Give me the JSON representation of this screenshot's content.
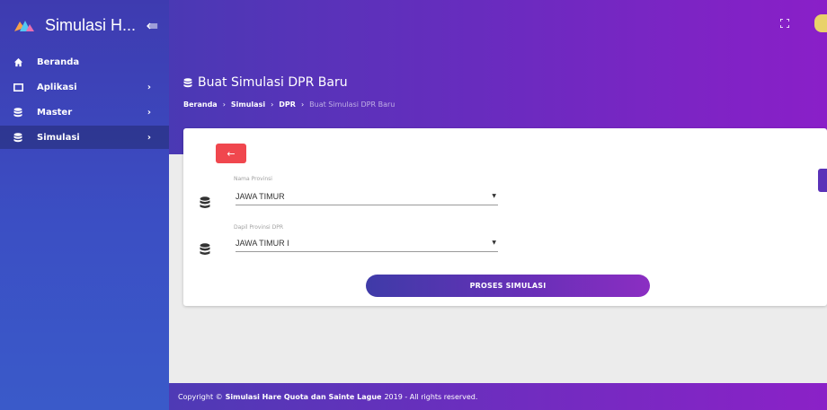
{
  "app": {
    "title": "Simulasi H..."
  },
  "sidebar": {
    "items": [
      {
        "label": "Beranda",
        "icon": "home-icon"
      },
      {
        "label": "Aplikasi",
        "icon": "window-icon"
      },
      {
        "label": "Master",
        "icon": "database-icon"
      },
      {
        "label": "Simulasi",
        "icon": "database-icon",
        "active": true
      }
    ]
  },
  "header": {
    "page_title": "Buat Simulasi DPR Baru",
    "breadcrumb": [
      "Beranda",
      "Simulasi",
      "DPR",
      "Buat Simulasi DPR Baru"
    ]
  },
  "form": {
    "provinsi_label": "Nama Provinsi",
    "provinsi_value": "JAWA TIMUR",
    "dapil_label": "Dapil Provinsi DPR",
    "dapil_value": "JAWA TIMUR I",
    "submit_label": "PROSES SIMULASI",
    "back_icon": "←"
  },
  "footer": {
    "prefix": "Copyright ©",
    "name": "Simulasi Hare Quota dan Sainte Lague",
    "suffix": "2019 - All rights reserved."
  },
  "colors": {
    "accent": "#5a32b8",
    "danger": "#f0474e"
  }
}
